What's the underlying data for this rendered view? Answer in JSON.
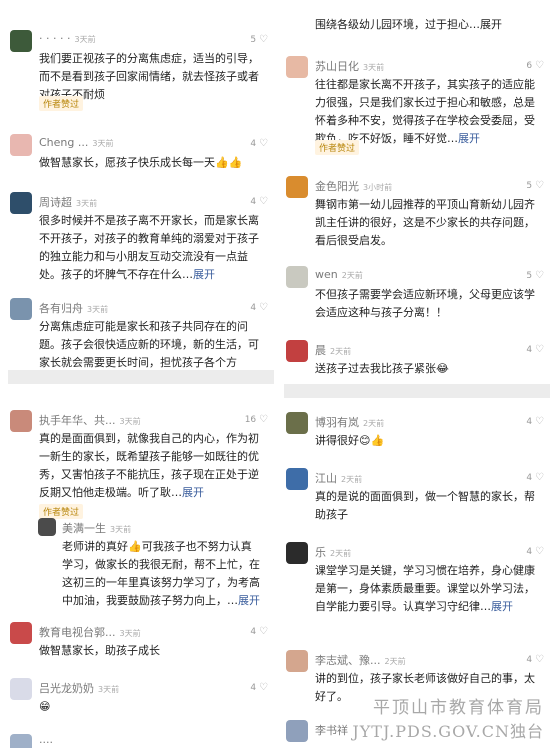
{
  "left_top": {
    "comments": [
      {
        "name": "· · · · ·",
        "time": "3天前",
        "likes": "5",
        "text": "我们要正视孩子的分离焦虑症，适当的引导，而不是看到孩子回家闹情绪，就去怪孩子或者对孩子不耐烦",
        "badge": "作者赞过"
      },
      {
        "name": "Cheng ...",
        "time": "3天前",
        "likes": "4",
        "text": "做智慧家长，愿孩子快乐成长每一天👍👍"
      },
      {
        "name": "周诗超",
        "time": "3天前",
        "likes": "4",
        "text": "很多时候并不是孩子离不开家长，而是家长离不开孩子，对孩子的教育单纯的溺爱对于孩子的独立能力和与小朋友互动交流没有一点益处。孩子的坏脾气不存在什么…",
        "more": "展开"
      },
      {
        "name": "各有归舟",
        "time": "3天前",
        "likes": "4",
        "text": "分离焦虑症可能是家长和孩子共同存在的问题。孩子会很快适应新的环境，新的生活，可家长就会需要更长时间，担忧孩子各个方"
      }
    ]
  },
  "left_bottom": {
    "comments": [
      {
        "name": "执手年华、共...",
        "time": "3天前",
        "likes": "16",
        "text": "真的是面面俱到，就像我自己的内心，作为初一新生的家长，既希望孩子能够一如既往的优秀，又害怕孩子不能抗压，孩子现在正处于逆反期又怕他走极端。听了耿…",
        "more": "展开",
        "badge": "作者赞过"
      },
      {
        "name": "美满一生",
        "time": "3天前",
        "likes": "",
        "text": "老师讲的真好👍可我孩子也不努力认真学习，做家长的我很无耐，帮不上忙，在这初三的一年里真该努力学习了，为考高中加油，我要鼓励孩子努力向上，…",
        "more": "展开"
      },
      {
        "name": "教育电视台郭...",
        "time": "3天前",
        "likes": "4",
        "text": "做智慧家长，助孩子成长"
      },
      {
        "name": "吕光龙奶奶",
        "time": "3天前",
        "likes": "4",
        "text": "😁"
      },
      {
        "name": "····",
        "time": "",
        "likes": "",
        "text": ""
      }
    ]
  },
  "right_top": {
    "top_line": "围绕各级幼儿园环境，过于担心…展开",
    "comments": [
      {
        "name": "苏山日化",
        "time": "3天前",
        "likes": "6",
        "text": "往往都是家长离不开孩子，其实孩子的适应能力很强，只是我们家长过于担心和敏感，总是怀着多种不安，觉得孩子在学校会受委屈，受欺负，吃不好饭，睡不好觉…",
        "more": "展开",
        "badge": "作者赞过"
      },
      {
        "name": "金色阳光",
        "time": "3小时前",
        "likes": "5",
        "text": "舞钢市第一幼儿园推荐的平顶山育新幼儿园齐凯主任讲的很好，这是不少家长的共存问题，看后很受启发。"
      },
      {
        "name": "wen",
        "time": "2天前",
        "likes": "5",
        "text": "不但孩子需要学会适应新环境，父母更应该学会适应这种与孩子分离！！"
      },
      {
        "name": "晨",
        "time": "2天前",
        "likes": "4",
        "text": "送孩子过去我比孩子紧张😂"
      }
    ]
  },
  "right_bottom": {
    "comments": [
      {
        "name": "博羽有岚",
        "time": "2天前",
        "likes": "4",
        "text": "讲得很好😊👍"
      },
      {
        "name": "江山",
        "time": "2天前",
        "likes": "4",
        "text": "真的是说的面面俱到，做一个智慧的家长，帮助孩子"
      },
      {
        "name": "乐",
        "time": "2天前",
        "likes": "4",
        "text": "课堂学习是关键，学习习惯在培养，身心健康是第一，身体素质最重要。课堂以外学习法，自学能力要引导。认真学习守纪律…",
        "more": "展开"
      },
      {
        "name": "李志斌、豫...",
        "time": "2天前",
        "likes": "4",
        "text": "讲的到位，孩子家长老师该做好自己的事，太好了。"
      },
      {
        "name": "李书祥",
        "time": "",
        "likes": "",
        "text": ""
      }
    ]
  },
  "watermark": {
    "line1": "平顶山市教育体育局",
    "line2": "JYTJ.PDS.GOV.CN独台"
  },
  "colors": {
    "link": "#3a5d9c",
    "badge_bg": "#fff3e0",
    "badge_text": "#b8860b"
  }
}
